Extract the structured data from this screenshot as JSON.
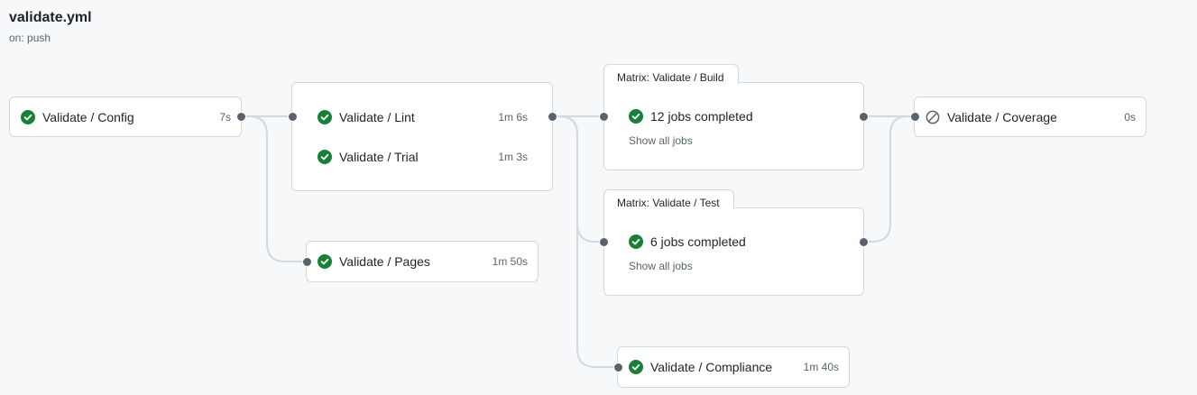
{
  "workflow": {
    "title": "validate.yml",
    "trigger": "on: push"
  },
  "colors": {
    "success": "#1a7f37",
    "skipped": "#59636e",
    "edge": "#d1d9e0"
  },
  "jobs": {
    "config": {
      "name": "Validate / Config",
      "duration": "7s",
      "status": "success",
      "icon": "check-circle-icon"
    },
    "lint": {
      "name": "Validate / Lint",
      "duration": "1m 6s",
      "status": "success",
      "icon": "check-circle-icon"
    },
    "trial": {
      "name": "Validate / Trial",
      "duration": "1m 3s",
      "status": "success",
      "icon": "check-circle-icon"
    },
    "pages": {
      "name": "Validate / Pages",
      "duration": "1m 50s",
      "status": "success",
      "icon": "check-circle-icon"
    },
    "compliance": {
      "name": "Validate / Compliance",
      "duration": "1m 40s",
      "status": "success",
      "icon": "check-circle-icon"
    },
    "coverage": {
      "name": "Validate / Coverage",
      "duration": "0s",
      "status": "skipped",
      "icon": "skip-icon"
    }
  },
  "matrix": {
    "build": {
      "title": "Matrix: Validate / Build",
      "summary": "12 jobs completed",
      "show_all": "Show all jobs",
      "icon": "check-circle-icon"
    },
    "test": {
      "title": "Matrix: Validate / Test",
      "summary": "6 jobs completed",
      "show_all": "Show all jobs",
      "icon": "check-circle-icon"
    }
  }
}
